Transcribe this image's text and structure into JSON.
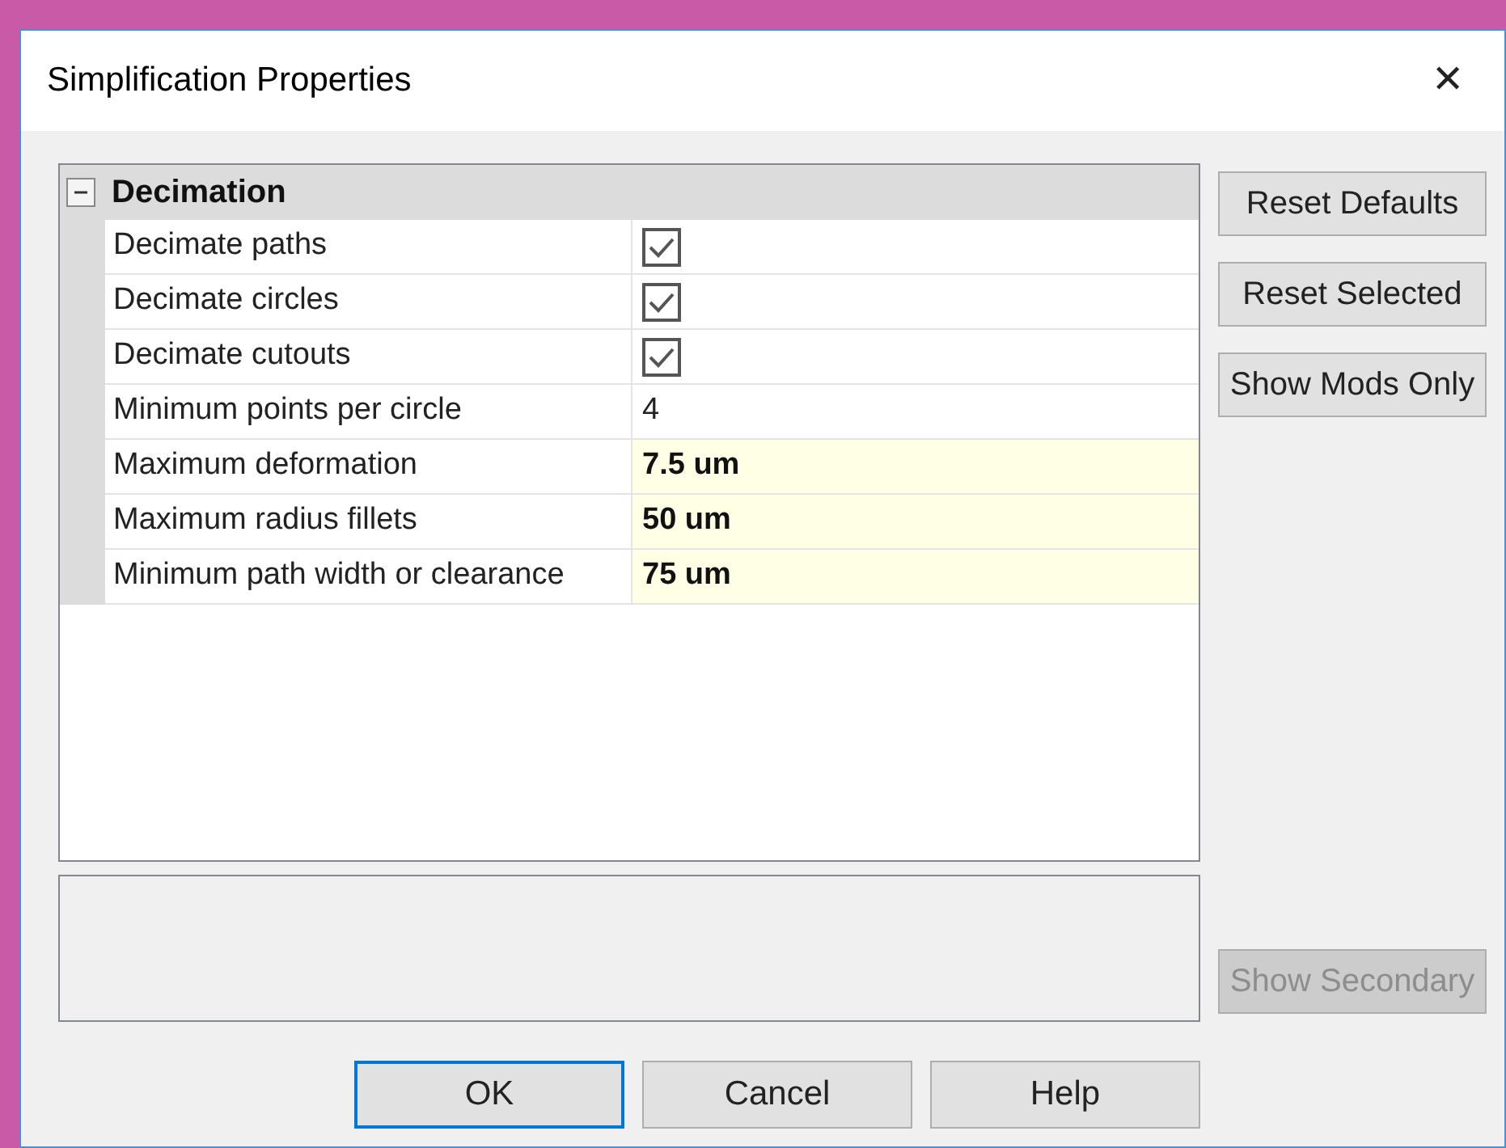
{
  "window": {
    "title": "Simplification Properties",
    "close": "✕"
  },
  "group": {
    "label": "Decimation",
    "expanded": true
  },
  "rows": [
    {
      "kind": "checkbox",
      "label": "Decimate paths",
      "checked": true,
      "modified": false
    },
    {
      "kind": "checkbox",
      "label": "Decimate circles",
      "checked": true,
      "modified": false
    },
    {
      "kind": "checkbox",
      "label": "Decimate cutouts",
      "checked": true,
      "modified": false
    },
    {
      "kind": "text",
      "label": "Minimum points per circle",
      "value": "4",
      "modified": false
    },
    {
      "kind": "text",
      "label": "Maximum deformation",
      "value": "7.5 um",
      "modified": true
    },
    {
      "kind": "text",
      "label": "Maximum radius fillets",
      "value": "50 um",
      "modified": true
    },
    {
      "kind": "text",
      "label": "Minimum path width or clearance",
      "value": "75 um",
      "modified": true
    }
  ],
  "side_buttons": [
    {
      "label": "Reset Defaults",
      "disabled": false
    },
    {
      "label": "Reset Selected",
      "disabled": false
    },
    {
      "label": "Show Mods Only",
      "disabled": false
    }
  ],
  "secondary_button": {
    "label": "Show Secondary",
    "disabled": true
  },
  "buttons": [
    {
      "label": "OK",
      "default": true
    },
    {
      "label": "Cancel",
      "default": false
    },
    {
      "label": "Help",
      "default": false
    }
  ]
}
